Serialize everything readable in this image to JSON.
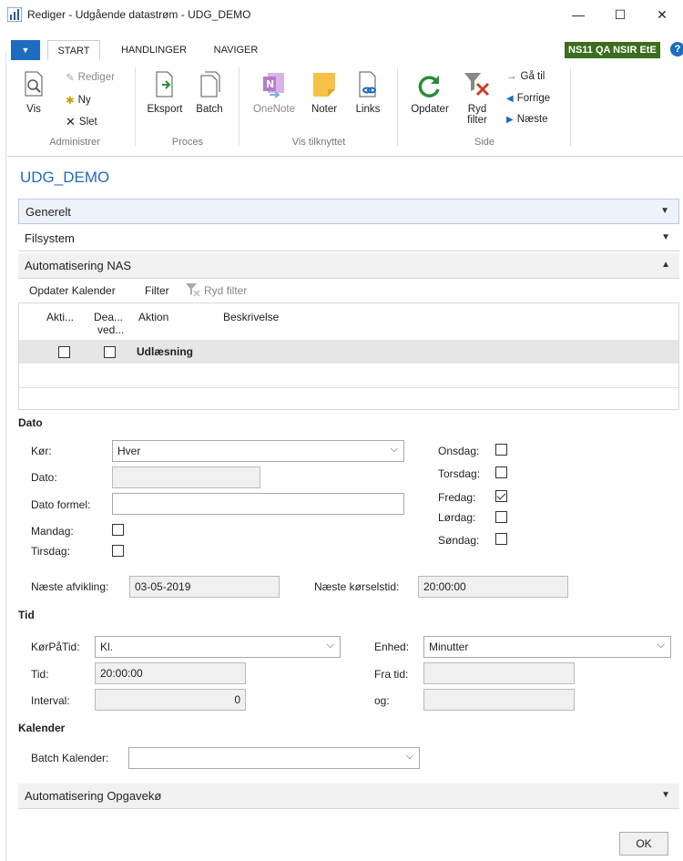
{
  "window": {
    "title": "Rediger - Udgående datastrøm - UDG_DEMO",
    "minimize": "—",
    "maximize": "☐",
    "close": "✕"
  },
  "tabs": [
    {
      "label": "START"
    },
    {
      "label": "HANDLINGER"
    },
    {
      "label": "NAVIGER"
    }
  ],
  "company": "NS11 QA NSIR EtE",
  "help": "?",
  "ribbon": {
    "administrer": {
      "vis": "Vis",
      "rediger": "Rediger",
      "ny": "Ny",
      "slet": "Slet",
      "group": "Administrer"
    },
    "proces": {
      "eksport": "Eksport",
      "batch": "Batch",
      "group": "Proces"
    },
    "tilknyttet": {
      "onenote": "OneNote",
      "noter": "Noter",
      "links": "Links",
      "group": "Vis tilknyttet"
    },
    "side": {
      "opdater": "Opdater",
      "ryd1": "Ryd",
      "ryd2": "filter",
      "gaatil": "Gå til",
      "forrige": "Forrige",
      "naeste": "Næste",
      "group": "Side"
    }
  },
  "page": {
    "title": "UDG_DEMO"
  },
  "fasttabs": {
    "generelt": "Generelt",
    "filsystem": "Filsystem",
    "automatisering_nas": "Automatisering NAS",
    "opgavekoe": "Automatisering Opgavekø"
  },
  "subactions": {
    "opdater_kalender": "Opdater Kalender",
    "filter": "Filter",
    "ryd_filter": "Ryd filter"
  },
  "grid": {
    "headers": {
      "akti": "Akti...",
      "dea1": "Dea...",
      "dea2": "ved...",
      "aktion": "Aktion",
      "beskrivelse": "Beskrivelse"
    },
    "rows": [
      {
        "aktiv": false,
        "deaktiveret": false,
        "aktion": "Udlæsning",
        "beskrivelse": ""
      }
    ]
  },
  "dato": {
    "section": "Dato",
    "koer_label": "Kør:",
    "koer_value": "Hver",
    "dato_label": "Dato:",
    "dato_value": "",
    "formel_label": "Dato formel:",
    "formel_value": "",
    "mandag_label": "Mandag:",
    "tirsdag_label": "Tirsdag:",
    "onsdag_label": "Onsdag:",
    "torsdag_label": "Torsdag:",
    "fredag_label": "Fredag:",
    "loerdag_label": "Lørdag:",
    "soendag_label": "Søndag:",
    "days_checked": {
      "mandag": false,
      "tirsdag": false,
      "onsdag": false,
      "torsdag": false,
      "fredag": true,
      "loerdag": false,
      "soendag": false
    },
    "naeste_afvikling_label": "Næste afvikling:",
    "naeste_afvikling_value": "03-05-2019",
    "naeste_koerselstid_label": "Næste kørselstid:",
    "naeste_koerselstid_value": "20:00:00"
  },
  "tid": {
    "section": "Tid",
    "koerpaatid_label": "KørPåTid:",
    "koerpaatid_value": "Kl.",
    "tid_label": "Tid:",
    "tid_value": "20:00:00",
    "interval_label": "Interval:",
    "interval_value": "0",
    "enhed_label": "Enhed:",
    "enhed_value": "Minutter",
    "fratid_label": "Fra tid:",
    "fratid_value": "",
    "og_label": "og:",
    "og_value": ""
  },
  "kalender": {
    "section": "Kalender",
    "batch_label": "Batch Kalender:",
    "batch_value": ""
  },
  "ok": "OK",
  "colors": {
    "accent": "#1e6cbf",
    "company": "#3c6d1f"
  }
}
